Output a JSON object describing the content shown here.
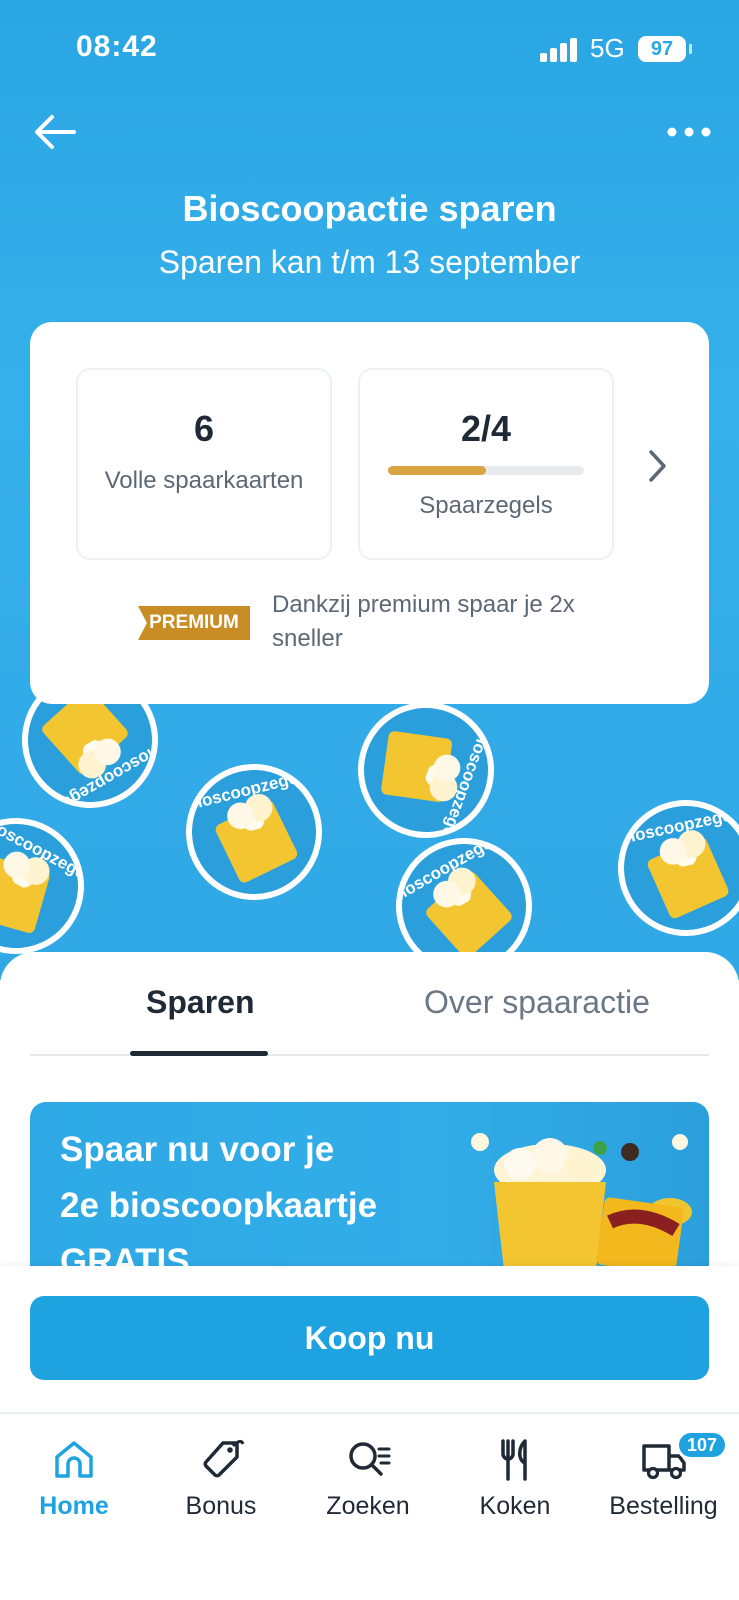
{
  "status_bar": {
    "time": "08:42",
    "network": "5G",
    "battery": "97"
  },
  "header": {
    "title": "Bioscoopactie sparen",
    "subtitle": "Sparen kan t/m 13 september"
  },
  "stickers": {
    "label": "Bioscoopzegel"
  },
  "summary": {
    "full_cards_value": "6",
    "full_cards_label": "Volle spaarkaarten",
    "stamps_value": "2/4",
    "stamps_label": "Spaarzegels",
    "stamps_progress": 0.5,
    "premium_badge": "PREMIUM",
    "premium_text": "Dankzij premium spaar je 2x sneller"
  },
  "tabs": [
    {
      "label": "Sparen",
      "active": true
    },
    {
      "label": "Over spaaractie",
      "active": false
    }
  ],
  "promo": {
    "line1": "Spaar nu voor je",
    "line2": "2e bioscoopkaartje",
    "line3": "GRATIS"
  },
  "buy_button": {
    "label": "Koop nu"
  },
  "nav": {
    "items": [
      {
        "label": "Home",
        "icon": "home-icon",
        "active": true
      },
      {
        "label": "Bonus",
        "icon": "tag-icon",
        "active": false
      },
      {
        "label": "Zoeken",
        "icon": "search-list-icon",
        "active": false
      },
      {
        "label": "Koken",
        "icon": "cutlery-icon",
        "active": false
      },
      {
        "label": "Bestelling",
        "icon": "delivery-truck-icon",
        "active": false,
        "badge": "107"
      }
    ]
  },
  "colors": {
    "brand_blue": "#1ea3e0",
    "hero_blue": "#2fa8e6",
    "premium_gold": "#c88d24",
    "progress_gold": "#d9a441"
  }
}
